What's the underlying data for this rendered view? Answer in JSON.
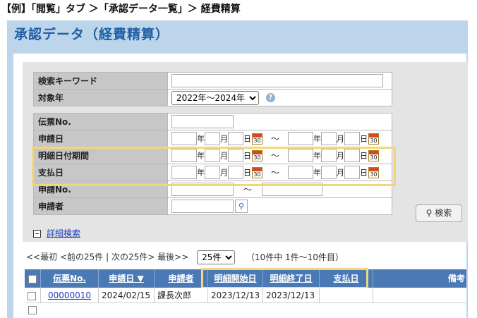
{
  "caption": "【例】「閲覧」タブ ＞「承認データ一覧」＞ 経費精算",
  "app_title": "承認データ（経費精算）",
  "form": {
    "keyword_label": "検索キーワード",
    "year_label": "対象年",
    "year_value": "2022年～2024年",
    "slip_no_label": "伝票No.",
    "apply_date_label": "申請日",
    "detail_date_label": "明細日付期間",
    "payment_date_label": "支払日",
    "apply_no_label": "申請No.",
    "applicant_label": "申請者",
    "unit_year": "年",
    "unit_month": "月",
    "unit_day": "日",
    "range_sep": "～",
    "calendar_day": "30",
    "help": "?",
    "search_button": "検索",
    "detail_search_link": "詳細検索"
  },
  "pager": {
    "first": "<<最初",
    "prev": "<前の25件",
    "sep": "|",
    "next": "次の25件>",
    "last": "最後>>",
    "page_size": "25件",
    "count": "（10件中 1件～10件目）"
  },
  "grid": {
    "headers": [
      "伝票No.",
      "申請日 ▼",
      "申請者",
      "明細開始日",
      "明細終了日",
      "支払日",
      "備考"
    ],
    "rows": [
      {
        "slip_no": "00000010",
        "apply_date": "2024/02/15",
        "applicant": "課長次郎",
        "detail_start": "2023/12/13",
        "detail_end": "2023/12/13",
        "payment_date": ""
      }
    ]
  },
  "colors": {
    "accent": "#1f5fa6",
    "header_bg": "#4b79b6",
    "highlight": "#f1d77a"
  }
}
